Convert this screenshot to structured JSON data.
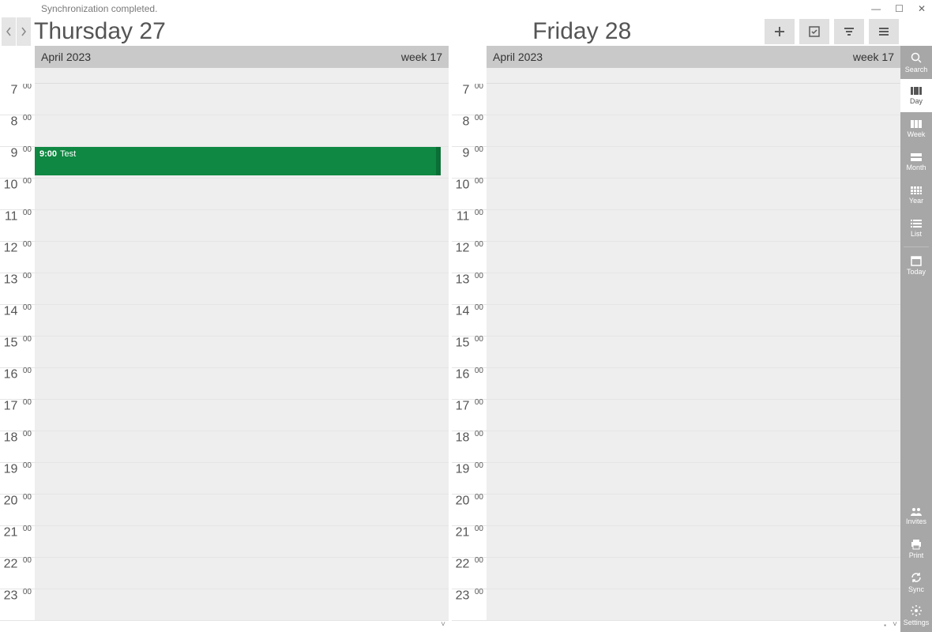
{
  "titlebar": {
    "status": "Synchronization completed."
  },
  "header": {
    "day1_title": "Thursday 27",
    "day2_title": "Friday 28"
  },
  "columns": [
    {
      "month": "April 2023",
      "week": "week 17"
    },
    {
      "month": "April 2023",
      "week": "week 17"
    }
  ],
  "hours": [
    "7",
    "8",
    "9",
    "10",
    "11",
    "12",
    "13",
    "14",
    "15",
    "16",
    "17",
    "18",
    "19",
    "20",
    "21",
    "22",
    "23"
  ],
  "minute_suffix": "00",
  "event": {
    "time": "9:00",
    "title": "Test",
    "hour_index": 2
  },
  "sidebar": {
    "search": "Search",
    "day": "Day",
    "week": "Week",
    "month": "Month",
    "year": "Year",
    "list": "List",
    "today": "Today",
    "invites": "Invites",
    "print": "Print",
    "sync": "Sync",
    "settings": "Settings"
  }
}
